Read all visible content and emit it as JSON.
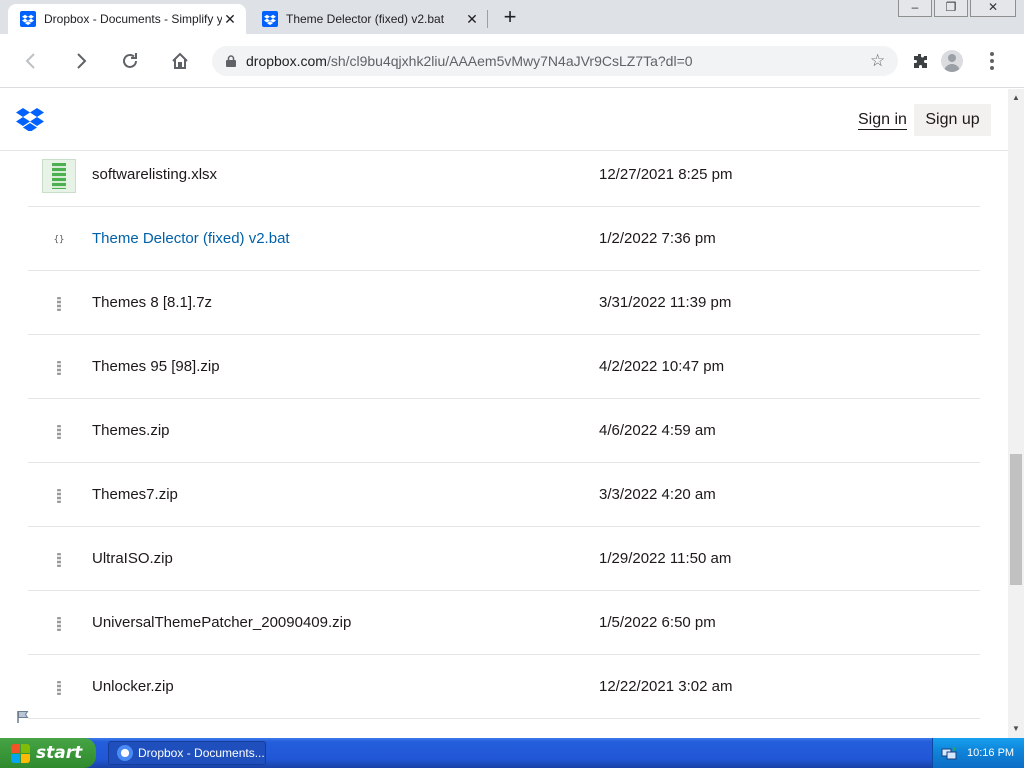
{
  "browser": {
    "tabs": [
      {
        "title": "Dropbox - Documents - Simplify your",
        "active": true
      },
      {
        "title": "Theme Delector (fixed) v2.bat",
        "active": false
      }
    ],
    "close_glyph": "✕",
    "newtab_glyph": "+",
    "window_buttons": {
      "minimize": "–",
      "restore": "❐",
      "close": "✕"
    },
    "address": {
      "host": "dropbox.com",
      "path": "/sh/cl9bu4qjxhk2liu/AAAem5vMwy7N4aJVr9CsLZ7Ta?dl=0"
    },
    "icons": [
      "back-icon",
      "forward-icon",
      "reload-icon",
      "home-icon",
      "lock-icon",
      "star-icon",
      "extensions-icon",
      "profile-icon",
      "menu-icon"
    ]
  },
  "site": {
    "sign_in": "Sign in",
    "sign_up": "Sign up",
    "brand_color": "#0061fe"
  },
  "files": [
    {
      "name": "softwarelisting.xlsx",
      "date": "12/27/2021 8:25 pm",
      "icon": "spreadsheet-icon"
    },
    {
      "name": "Theme Delector (fixed) v2.bat",
      "date": "1/2/2022 7:36 pm",
      "icon": "code-icon",
      "highlighted": true
    },
    {
      "name": "Themes 8 [8.1].7z",
      "date": "3/31/2022 11:39 pm",
      "icon": "zip-icon"
    },
    {
      "name": "Themes 95 [98].zip",
      "date": "4/2/2022 10:47 pm",
      "icon": "zip-icon"
    },
    {
      "name": "Themes.zip",
      "date": "4/6/2022 4:59 am",
      "icon": "zip-icon"
    },
    {
      "name": "Themes7.zip",
      "date": "3/3/2022 4:20 am",
      "icon": "zip-icon"
    },
    {
      "name": "UltraISO.zip",
      "date": "1/29/2022 11:50 am",
      "icon": "zip-icon"
    },
    {
      "name": "UniversalThemePatcher_20090409.zip",
      "date": "1/5/2022 6:50 pm",
      "icon": "zip-icon"
    },
    {
      "name": "Unlocker.zip",
      "date": "12/22/2021 3:02 am",
      "icon": "zip-icon"
    }
  ],
  "taskbar": {
    "start_label": "start",
    "task_label": "Dropbox - Documents...",
    "clock": "10:16 PM"
  }
}
